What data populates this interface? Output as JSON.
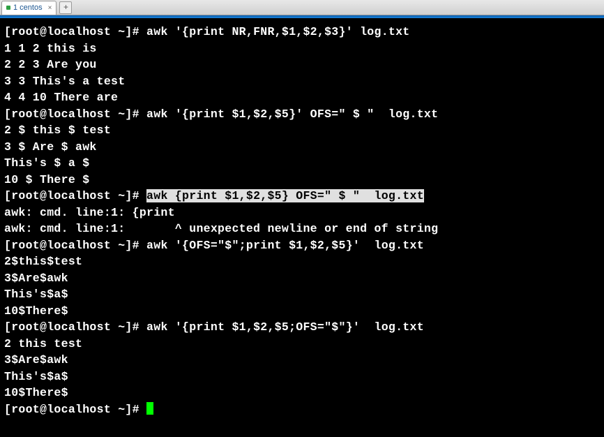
{
  "tabs": {
    "active_label": "1 centos",
    "close_glyph": "×",
    "add_glyph": "+"
  },
  "prompt": "[root@localhost ~]# ",
  "lines": [
    {
      "type": "cmd",
      "text": "awk '{print NR,FNR,$1,$2,$3}' log.txt"
    },
    {
      "type": "out",
      "text": "1 1 2 this is"
    },
    {
      "type": "out",
      "text": "2 2 3 Are you"
    },
    {
      "type": "out",
      "text": "3 3 This's a test"
    },
    {
      "type": "out",
      "text": "4 4 10 There are"
    },
    {
      "type": "cmd",
      "text": "awk '{print $1,$2,$5}' OFS=\" $ \"  log.txt"
    },
    {
      "type": "out",
      "text": "2 $ this $ test"
    },
    {
      "type": "out",
      "text": "3 $ Are $ awk"
    },
    {
      "type": "out",
      "text": "This's $ a $ "
    },
    {
      "type": "out",
      "text": "10 $ There $ "
    },
    {
      "type": "cmd_hl",
      "text": "awk {print $1,$2,$5} OFS=\" $ \"  log.txt"
    },
    {
      "type": "out",
      "text": "awk: cmd. line:1: {print"
    },
    {
      "type": "out",
      "text": "awk: cmd. line:1:       ^ unexpected newline or end of string"
    },
    {
      "type": "cmd",
      "text": "awk '{OFS=\"$\";print $1,$2,$5}'  log.txt"
    },
    {
      "type": "out",
      "text": "2$this$test"
    },
    {
      "type": "out",
      "text": "3$Are$awk"
    },
    {
      "type": "out",
      "text": "This's$a$"
    },
    {
      "type": "out",
      "text": "10$There$"
    },
    {
      "type": "cmd",
      "text": "awk '{print $1,$2,$5;OFS=\"$\"}'  log.txt"
    },
    {
      "type": "out",
      "text": "2 this test"
    },
    {
      "type": "out",
      "text": "3$Are$awk"
    },
    {
      "type": "out",
      "text": "This's$a$"
    },
    {
      "type": "out",
      "text": "10$There$"
    },
    {
      "type": "cursor",
      "text": ""
    }
  ]
}
